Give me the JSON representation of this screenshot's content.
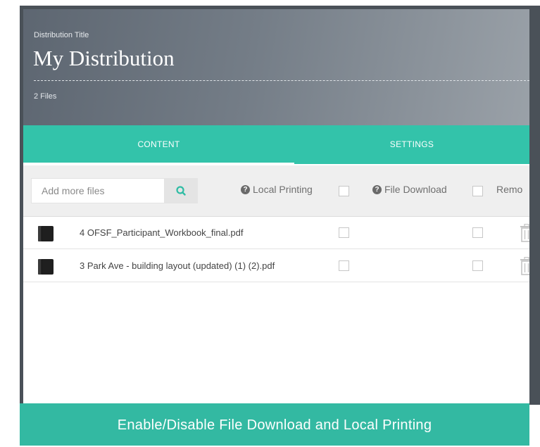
{
  "header": {
    "label": "Distribution Title",
    "title": "My Distribution",
    "file_count": "2 Files"
  },
  "tabs": [
    {
      "label": "CONTENT",
      "active": true
    },
    {
      "label": "SETTINGS",
      "active": false
    }
  ],
  "toolbar": {
    "search_placeholder": "Add more files",
    "search_icon": "search-icon",
    "local_printing_label": "Local Printing",
    "file_download_label": "File Download",
    "remove_label": "Remo",
    "help_icon": "question-circle-icon"
  },
  "files": [
    {
      "name": "4 OFSF_Participant_Workbook_final.pdf",
      "local_printing": false,
      "file_download": false,
      "icon": "book-icon"
    },
    {
      "name": "3 Park Ave - building layout (updated) (1) (2).pdf",
      "local_printing": false,
      "file_download": false,
      "icon": "book-icon"
    }
  ],
  "caption": "Enable/Disable File Download and Local Printing",
  "colors": {
    "accent": "#33c3aa",
    "banner": "#33b9a2",
    "header_start": "#5d6671",
    "header_end": "#9aa1a8"
  }
}
